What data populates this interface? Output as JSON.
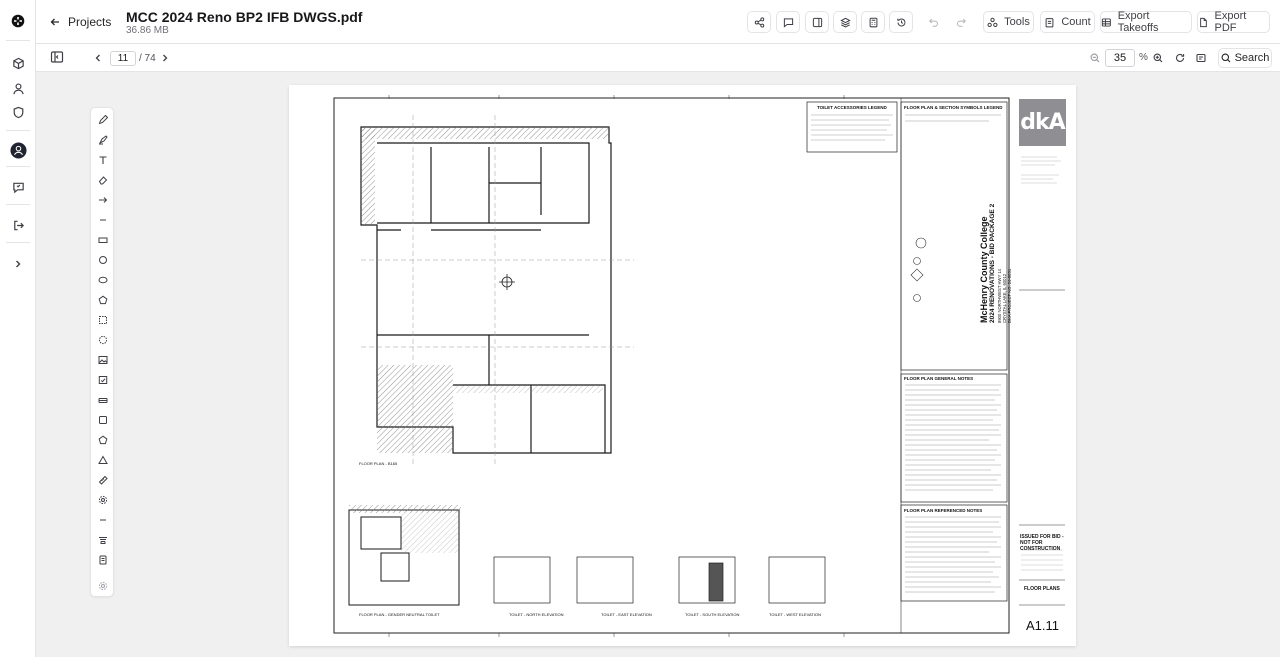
{
  "app": {
    "back_label": "Projects",
    "document_title": "MCC 2024 Reno BP2 IFB DWGS.pdf",
    "document_size": "36.86 MB"
  },
  "header_actions": {
    "tools": "Tools",
    "count": "Count",
    "export_takeoffs": "Export Takeoffs",
    "export_pdf": "Export PDF"
  },
  "pager": {
    "current_page": "11",
    "total_pages": "/ 74"
  },
  "zoom": {
    "value": "35",
    "unit": "%",
    "search_label": "Search"
  },
  "sheet": {
    "logo_text": "dkA",
    "accessories_legend": "TOILET ACCESSORIES LEGEND",
    "symbols_legend": "FLOOR PLAN & SECTION SYMBOLS LEGEND",
    "general_notes": "FLOOR PLAN GENERAL NOTES",
    "referenced_notes": "FLOOR PLAN REFERENCED NOTES",
    "project_line1": "McHenry County College",
    "project_line2": "2024 RENOVATIONS - BID PACKAGE 2",
    "project_line3": "8900 NORTHWEST HWY 14",
    "project_line4": "CRYSTAL LAKE, IL 60012",
    "project_line5": "DKA PROJECT NO. 24-0031",
    "issued": "ISSUED FOR BID - NOT FOR CONSTRUCTION",
    "sheet_title": "FLOOR PLANS",
    "sheet_number": "A1.11",
    "views": {
      "floor_plan": "FLOOR PLAN - B165",
      "gender_neutral": "FLOOR PLAN - GENDER NEUTRAL TOILET",
      "north_elev": "TOILET - NORTH ELEVATION",
      "east_elev": "TOILET - EAST ELEVATION",
      "south_elev": "TOILET - SOUTH ELEVATION",
      "west_elev": "TOILET - WEST ELEVATION"
    }
  },
  "colors": {
    "accent": "#18181b",
    "logo_gray": "#8e8e93",
    "border": "#e4e4e7"
  },
  "icons": {
    "rail": [
      "app-logo-icon",
      "cube-icon",
      "user-icon",
      "shield-icon",
      "avatar",
      "chat-icon",
      "logout-icon",
      "chevron-right-icon"
    ],
    "header": [
      "share-icon",
      "comment-icon",
      "sidebar-icon",
      "layers-icon",
      "calculator-icon",
      "history-icon",
      "undo-icon",
      "redo-icon"
    ]
  }
}
